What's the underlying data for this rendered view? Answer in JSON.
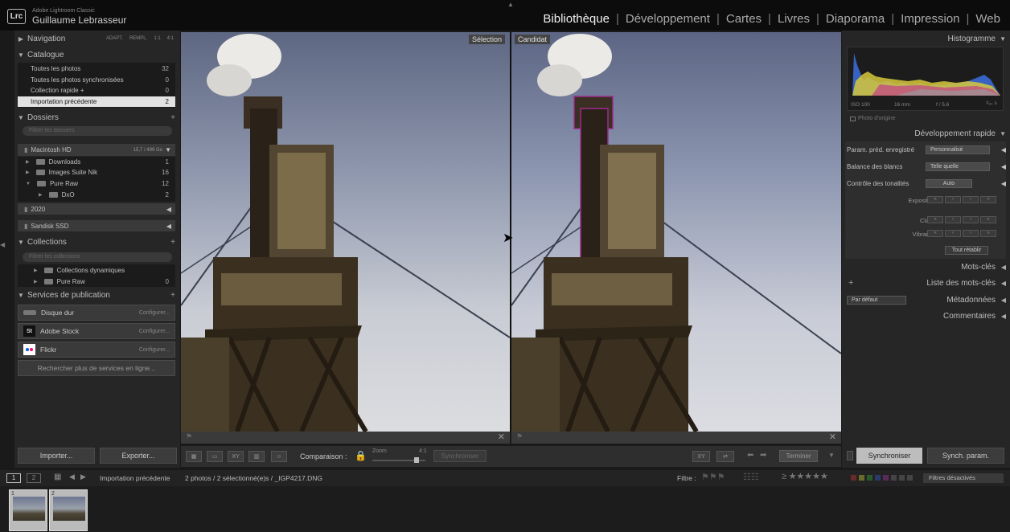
{
  "app": {
    "name": "Adobe Lightroom Classic",
    "user": "Guillaume Lebrasseur",
    "logo": "Lrc"
  },
  "modules": [
    "Bibliothèque",
    "Développement",
    "Cartes",
    "Livres",
    "Diaporama",
    "Impression",
    "Web"
  ],
  "active_module": "Bibliothèque",
  "left_panel": {
    "navigation": {
      "title": "Navigation",
      "options": [
        "ADAPT.",
        "REMPL.",
        "1:1",
        "4:1"
      ]
    },
    "catalogue": {
      "title": "Catalogue",
      "items": [
        {
          "label": "Toutes les photos",
          "count": "32"
        },
        {
          "label": "Toutes les photos synchronisées",
          "count": "0"
        },
        {
          "label": "Collection rapide +",
          "count": "0"
        },
        {
          "label": "Importation précédente",
          "count": "2"
        }
      ]
    },
    "dossiers": {
      "title": "Dossiers",
      "search_placeholder": "Filtrer les dossiers",
      "volume": {
        "label": "Macintosh HD",
        "size": "15,7 / 499 Go"
      },
      "folders": [
        {
          "label": "Downloads",
          "count": "1"
        },
        {
          "label": "Images Suite Nik",
          "count": "16"
        },
        {
          "label": "Pure Raw",
          "count": "12"
        },
        {
          "label": "DxO",
          "count": "2"
        }
      ],
      "other_volumes": [
        "2020",
        "Sandisk SSD"
      ]
    },
    "collections": {
      "title": "Collections",
      "search_placeholder": "Filtrer les collections",
      "items": [
        {
          "label": "Collections dynamiques",
          "count": ""
        },
        {
          "label": "Pure Raw",
          "count": "0"
        }
      ]
    },
    "publication": {
      "title": "Services de publication",
      "services": [
        {
          "label": "Disque dur",
          "action": "Configurer..."
        },
        {
          "label": "Adobe Stock",
          "action": "Configurer..."
        },
        {
          "label": "Flickr",
          "action": "Configurer..."
        }
      ],
      "more": "Rechercher plus de services en ligne..."
    },
    "import_label": "Importer...",
    "export_label": "Exporter..."
  },
  "viewer": {
    "select_label": "Sélection",
    "candidate_label": "Candidat"
  },
  "toolbar": {
    "compare_label": "Comparaison :",
    "zoom_label": "Zoom",
    "zoom_value": "4:1",
    "sync_label": "Synchroniser",
    "done_label": "Terminer"
  },
  "right_panel": {
    "histogram": {
      "title": "Histogramme",
      "iso": "ISO 100",
      "focal": "16 mm",
      "aperture": "f / 5,6",
      "shutter": "¹⁄₈₀ s",
      "original": "Photo d'origine"
    },
    "quick_develop": {
      "title": "Développement rapide",
      "preset_label": "Param. préd. enregistré",
      "preset_value": "Personnalisé",
      "wb_label": "Balance des blancs",
      "wb_value": "Telle quelle",
      "tone_label": "Contrôle des tonalités",
      "tone_value": "Auto",
      "sliders": [
        "Exposition",
        "Clarté",
        "Vibrance"
      ],
      "reset_label": "Tout rétablir"
    },
    "keywords": "Mots-clés",
    "keyword_list": "Liste des mots-clés",
    "metadata": "Métadonnées",
    "metadata_preset": "Par défaut",
    "comments": "Commentaires",
    "sync_button": "Synchroniser",
    "sync_settings_button": "Synch. param."
  },
  "filmstrip": {
    "pages": [
      "1",
      "2"
    ],
    "source": "Importation précédente",
    "info": "2 photos / 2 sélectionné(e)s / _IGP4217.DNG",
    "filter_label": "Filtre :",
    "filter_status": "Filtres désactivés",
    "thumbs": [
      "1",
      "2"
    ]
  },
  "colors": {
    "accent_selected": "#e2e2e2",
    "panel": "#262626",
    "topbar": "#0c0c0c"
  }
}
